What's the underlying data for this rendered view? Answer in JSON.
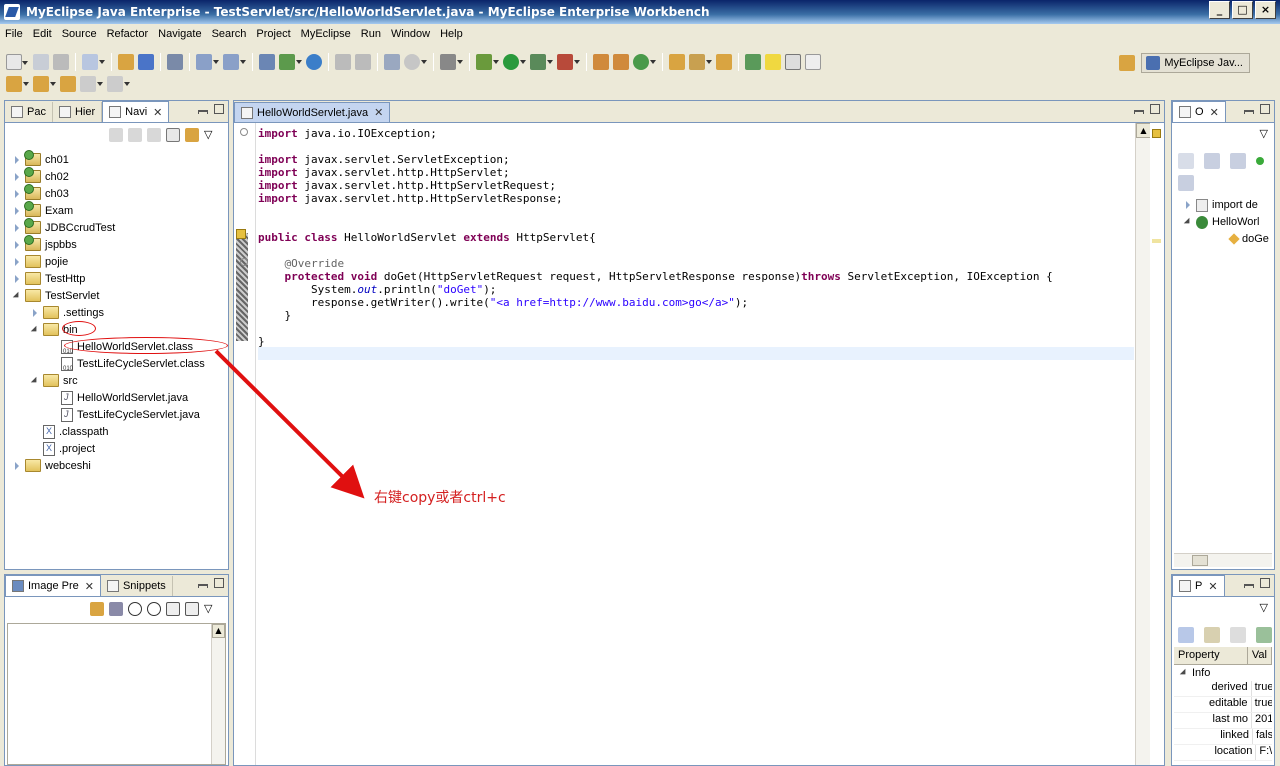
{
  "window": {
    "title": "MyEclipse Java Enterprise - TestServlet/src/HelloWorldServlet.java - MyEclipse Enterprise Workbench"
  },
  "menu": [
    "File",
    "Edit",
    "Source",
    "Refactor",
    "Navigate",
    "Search",
    "Project",
    "MyEclipse",
    "Run",
    "Window",
    "Help"
  ],
  "perspective": {
    "label": "MyEclipse Jav..."
  },
  "nav_view": {
    "tabs": [
      "Pac",
      "Hier",
      "Navi"
    ],
    "tree": [
      {
        "label": "ch01",
        "kind": "project",
        "level": 0,
        "state": "closed"
      },
      {
        "label": "ch02",
        "kind": "project",
        "level": 0,
        "state": "closed"
      },
      {
        "label": "ch03",
        "kind": "project",
        "level": 0,
        "state": "closed"
      },
      {
        "label": "Exam",
        "kind": "project",
        "level": 0,
        "state": "closed"
      },
      {
        "label": "JDBCcrudTest",
        "kind": "project",
        "level": 0,
        "state": "closed"
      },
      {
        "label": "jspbbs",
        "kind": "project",
        "level": 0,
        "state": "closed"
      },
      {
        "label": "pojie",
        "kind": "folder",
        "level": 0,
        "state": "closed"
      },
      {
        "label": "TestHttp",
        "kind": "folder",
        "level": 0,
        "state": "closed"
      },
      {
        "label": "TestServlet",
        "kind": "folder",
        "level": 0,
        "state": "open"
      },
      {
        "label": ".settings",
        "kind": "folder",
        "level": 1,
        "state": "closed"
      },
      {
        "label": "bin",
        "kind": "folder",
        "level": 1,
        "state": "open"
      },
      {
        "label": "HelloWorldServlet.class",
        "kind": "classfile",
        "level": 2,
        "state": "none"
      },
      {
        "label": "TestLifeCycleServlet.class",
        "kind": "classfile",
        "level": 2,
        "state": "none"
      },
      {
        "label": "src",
        "kind": "folder",
        "level": 1,
        "state": "open"
      },
      {
        "label": "HelloWorldServlet.java",
        "kind": "javafile",
        "level": 2,
        "state": "none"
      },
      {
        "label": "TestLifeCycleServlet.java",
        "kind": "javafile",
        "level": 2,
        "state": "none"
      },
      {
        "label": ".classpath",
        "kind": "xmlfile",
        "level": 1,
        "state": "none"
      },
      {
        "label": ".project",
        "kind": "xmlfile",
        "level": 1,
        "state": "none"
      },
      {
        "label": "webceshi",
        "kind": "folder",
        "level": 0,
        "state": "closed"
      }
    ]
  },
  "image_view": {
    "tabs": [
      "Image Pre",
      "Snippets"
    ]
  },
  "editor": {
    "tab": "HelloWorldServlet.java",
    "lines": [
      [
        [
          "kw",
          "import"
        ],
        [
          "t",
          " java.io.IOException;"
        ]
      ],
      [],
      [
        [
          "kw",
          "import"
        ],
        [
          "t",
          " javax.servlet.ServletException;"
        ]
      ],
      [
        [
          "kw",
          "import"
        ],
        [
          "t",
          " javax.servlet.http.HttpServlet;"
        ]
      ],
      [
        [
          "kw",
          "import"
        ],
        [
          "t",
          " javax.servlet.http.HttpServletRequest;"
        ]
      ],
      [
        [
          "kw",
          "import"
        ],
        [
          "t",
          " javax.servlet.http.HttpServletResponse;"
        ]
      ],
      [],
      [],
      [
        [
          "kw",
          "public"
        ],
        [
          "t",
          " "
        ],
        [
          "kw",
          "class"
        ],
        [
          "t",
          " HelloWorldServlet "
        ],
        [
          "kw",
          "extends"
        ],
        [
          "t",
          " HttpServlet{"
        ]
      ],
      [],
      [
        [
          "t",
          "    "
        ],
        [
          "ann",
          "@Override"
        ]
      ],
      [
        [
          "t",
          "    "
        ],
        [
          "kw",
          "protected"
        ],
        [
          "t",
          " "
        ],
        [
          "kw",
          "void"
        ],
        [
          "t",
          " doGet(HttpServletRequest request, HttpServletResponse response)"
        ],
        [
          "kw",
          "throws"
        ],
        [
          "t",
          " ServletException, IOException {"
        ]
      ],
      [
        [
          "t",
          "        System."
        ],
        [
          "fld",
          "out"
        ],
        [
          "t",
          ".println("
        ],
        [
          "str",
          "\"doGet\""
        ],
        [
          "t",
          ");"
        ]
      ],
      [
        [
          "t",
          "        response.getWriter().write("
        ],
        [
          "str",
          "\"<a href=http://www.baidu.com>go</a>\""
        ],
        [
          "t",
          ");"
        ]
      ],
      [
        [
          "t",
          "    }"
        ]
      ],
      [],
      [
        [
          "t",
          "}"
        ]
      ]
    ]
  },
  "outline_view": {
    "tab": "O",
    "nodes": [
      "import de",
      "HelloWorl",
      "doGe"
    ]
  },
  "properties_view": {
    "tab": "P",
    "headers": [
      "Property",
      "Val"
    ],
    "group": "Info",
    "rows": [
      {
        "k": "derived",
        "v": "true"
      },
      {
        "k": "editable",
        "v": "true"
      },
      {
        "k": "last mo",
        "v": "201"
      },
      {
        "k": "linked",
        "v": "fals"
      },
      {
        "k": "location",
        "v": "F:\\"
      }
    ]
  },
  "annotation": {
    "note": "右键copy或者ctrl+c",
    "color": "#d42020"
  }
}
